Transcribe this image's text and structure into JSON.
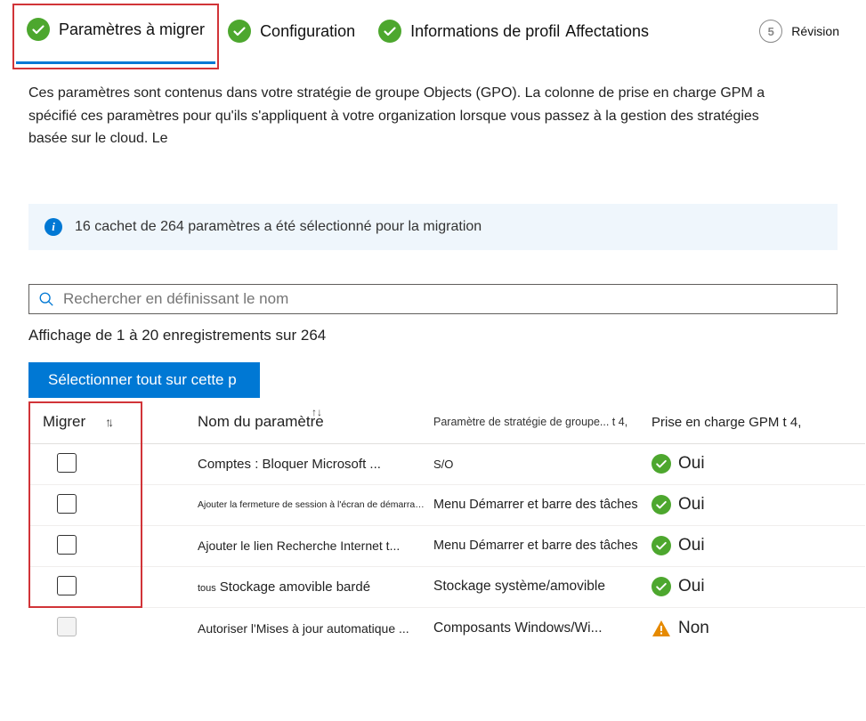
{
  "wizard": {
    "steps": [
      {
        "label": "Paramètres à migrer",
        "status": "check",
        "active": true
      },
      {
        "label": "Configuration",
        "status": "check",
        "active": false
      },
      {
        "label": "Informations de profil",
        "status": "check",
        "active": false
      },
      {
        "label": "Affectations",
        "status": "check",
        "active": false
      },
      {
        "label": "Révision",
        "status": "5",
        "active": false
      }
    ]
  },
  "description": "Ces paramètres sont contenus dans votre stratégie de groupe Objects (GPO). La colonne de prise en charge GPM a spécifié ces paramètres pour qu'ils s'appliquent à votre organization lorsque vous passez à la gestion des stratégies basée sur le cloud. Le",
  "info_bar": "16 cachet de 264 paramètres a été sélectionné pour la migration",
  "search_placeholder": "Rechercher en définissant le nom",
  "records_label": "Affichage de 1 à 20 enregistrements sur 264",
  "select_all_label": "Sélectionner tout sur cette p",
  "columns": {
    "migrer": "Migrer",
    "nom": "Nom du paramètre",
    "param": "Paramètre de stratégie de groupe... t 4,",
    "gpm": "Prise en charge GPM t 4,"
  },
  "rows": [
    {
      "nom": "Comptes : Bloquer Microsoft ...",
      "nom_size": "normal",
      "param": "S/O",
      "gpm_label": "Oui",
      "gpm_status": "ok",
      "disabled": false
    },
    {
      "nom": "Ajouter la fermeture de session à l'écran de démarrage M...",
      "nom_size": "tiny",
      "param": "Menu Démarrer et barre des tâches",
      "gpm_label": "Oui",
      "gpm_status": "ok",
      "disabled": false
    },
    {
      "nom": "Ajouter le lien Recherche Internet t...",
      "nom_size": "normal",
      "param": "Menu Démarrer et barre des tâches",
      "gpm_label": "Oui",
      "gpm_status": "ok",
      "disabled": false
    },
    {
      "nom_prefix": "tous",
      "nom": "Stockage amovible bardé",
      "nom_size": "prefix",
      "param": "Stockage système/amovible",
      "gpm_label": "Oui",
      "gpm_status": "ok",
      "disabled": false
    },
    {
      "nom": "Autoriser l'Mises à jour automatique ...",
      "nom_size": "normal",
      "param": "Composants Windows/Wi...",
      "gpm_label": "Non",
      "gpm_status": "warn",
      "disabled": true
    }
  ]
}
